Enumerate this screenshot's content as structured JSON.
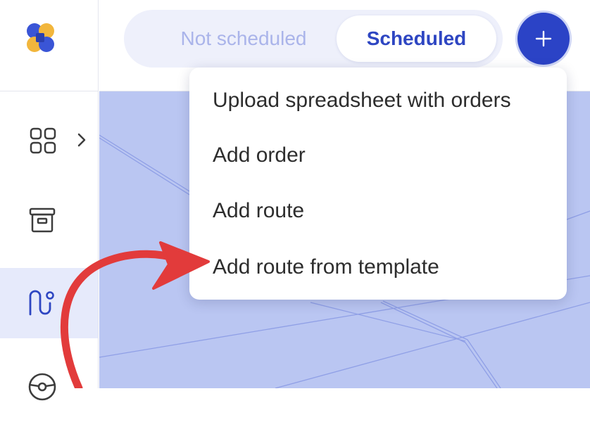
{
  "tabs": {
    "not_scheduled": "Not scheduled",
    "scheduled": "Scheduled",
    "active": "Scheduled"
  },
  "add_menu": {
    "items": [
      {
        "label": "Upload spreadsheet with orders"
      },
      {
        "label": "Add order"
      },
      {
        "label": "Add route"
      },
      {
        "label": "Add route from template"
      }
    ]
  },
  "sidebar": {
    "items": [
      {
        "icon": "grid-icon",
        "has_chevron": true
      },
      {
        "icon": "archive-icon"
      },
      {
        "icon": "route-icon",
        "active": true
      },
      {
        "icon": "steering-wheel-icon"
      }
    ]
  },
  "colors": {
    "accent": "#2b43c6",
    "map": "#bac6f2",
    "annotation_arrow": "#e23b3b"
  }
}
